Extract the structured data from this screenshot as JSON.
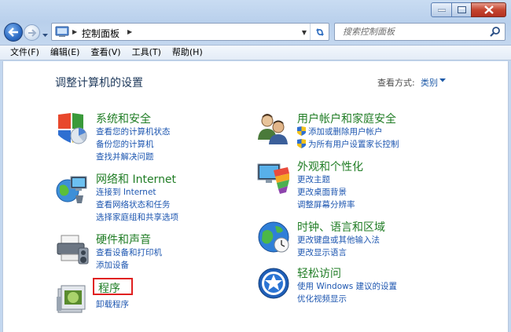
{
  "window": {
    "controls": [
      "minimize",
      "maximize",
      "close"
    ]
  },
  "nav": {
    "address": {
      "segments": [
        "控制面板"
      ],
      "icon": "control-panel-icon"
    },
    "search": {
      "placeholder": "搜索控制面板"
    }
  },
  "menubar": {
    "items": [
      "文件(F)",
      "编辑(E)",
      "查看(V)",
      "工具(T)",
      "帮助(H)"
    ]
  },
  "main": {
    "title": "调整计算机的设置",
    "view_by_label": "查看方式:",
    "view_by_value": "类别"
  },
  "categories": [
    {
      "title": "系统和安全",
      "icon": "system-security-icon",
      "links": [
        "查看您的计算机状态",
        "备份您的计算机",
        "查找并解决问题"
      ]
    },
    {
      "title": "网络和 Internet",
      "icon": "network-icon",
      "links": [
        "连接到 Internet",
        "查看网络状态和任务",
        "选择家庭组和共享选项"
      ]
    },
    {
      "title": "硬件和声音",
      "icon": "hardware-sound-icon",
      "links": [
        "查看设备和打印机",
        "添加设备"
      ]
    },
    {
      "title": "程序",
      "icon": "programs-icon",
      "links": [
        "卸载程序"
      ]
    },
    {
      "title": "用户帐户和家庭安全",
      "icon": "user-accounts-icon",
      "links": [
        "添加或删除用户帐户",
        "为所有用户设置家长控制"
      ]
    },
    {
      "title": "外观和个性化",
      "icon": "appearance-icon",
      "links": [
        "更改主题",
        "更改桌面背景",
        "调整屏幕分辨率"
      ]
    },
    {
      "title": "时钟、语言和区域",
      "icon": "clock-region-icon",
      "links": [
        "更改键盘或其他输入法",
        "更改显示语言"
      ]
    },
    {
      "title": "轻松访问",
      "icon": "ease-of-access-icon",
      "links": [
        "使用 Windows 建议的设置",
        "优化视频显示"
      ]
    }
  ],
  "colors": {
    "category_title": "#207d25",
    "link": "#1d56b0",
    "page_title": "#1e395b",
    "highlight_box": "#e02020"
  }
}
